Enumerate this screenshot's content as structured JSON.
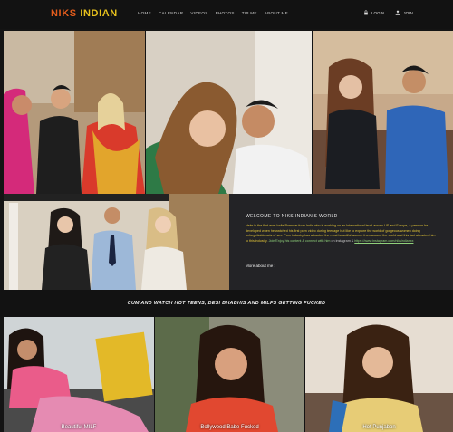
{
  "header": {
    "logo_part1": "NIKS",
    "logo_part2": "INDIAN",
    "nav": [
      "HOME",
      "CALENDAR",
      "VIDEOS",
      "PHOTOS",
      "TIP ME",
      "ABOUT ME"
    ],
    "login_label": "LOGIN",
    "join_label": "JOIN"
  },
  "welcome": {
    "title": "WELCOME TO NIKS INDIAN'S WORLD",
    "p1": "Neks is the first ever Indie Pornstar from India who is working on an International level across US and Europe,",
    "p2": "a passion he developed when he watched his first porn video during teenage but like to explore the world of",
    "p3": "gorgeous women doing unforgettable acts of sex.",
    "p4": "Porn industry has attracted the most beautiful women from",
    "p5": "around the world and this fact attracted him to this industry.",
    "p6": "Join/Enjoy his content & connect with him",
    "p7": "on instagram & ",
    "link": "https://www.instagram.com/niksindianxx",
    "more_label": "More about me"
  },
  "banner_text": "CUM AND WATCH HOT TEENS, DESI BHABHIS AND MILFS GETTING FUCKED",
  "videos": [
    {
      "caption": "Beautiful MILF"
    },
    {
      "caption": "Bollywood Babe Fucked"
    },
    {
      "caption": "Hot Punjabon"
    }
  ],
  "colors": {
    "logo1": "#e25c1c",
    "logo2": "#e8c21d",
    "panel": "#232326",
    "accent_green": "#8fd07a"
  }
}
